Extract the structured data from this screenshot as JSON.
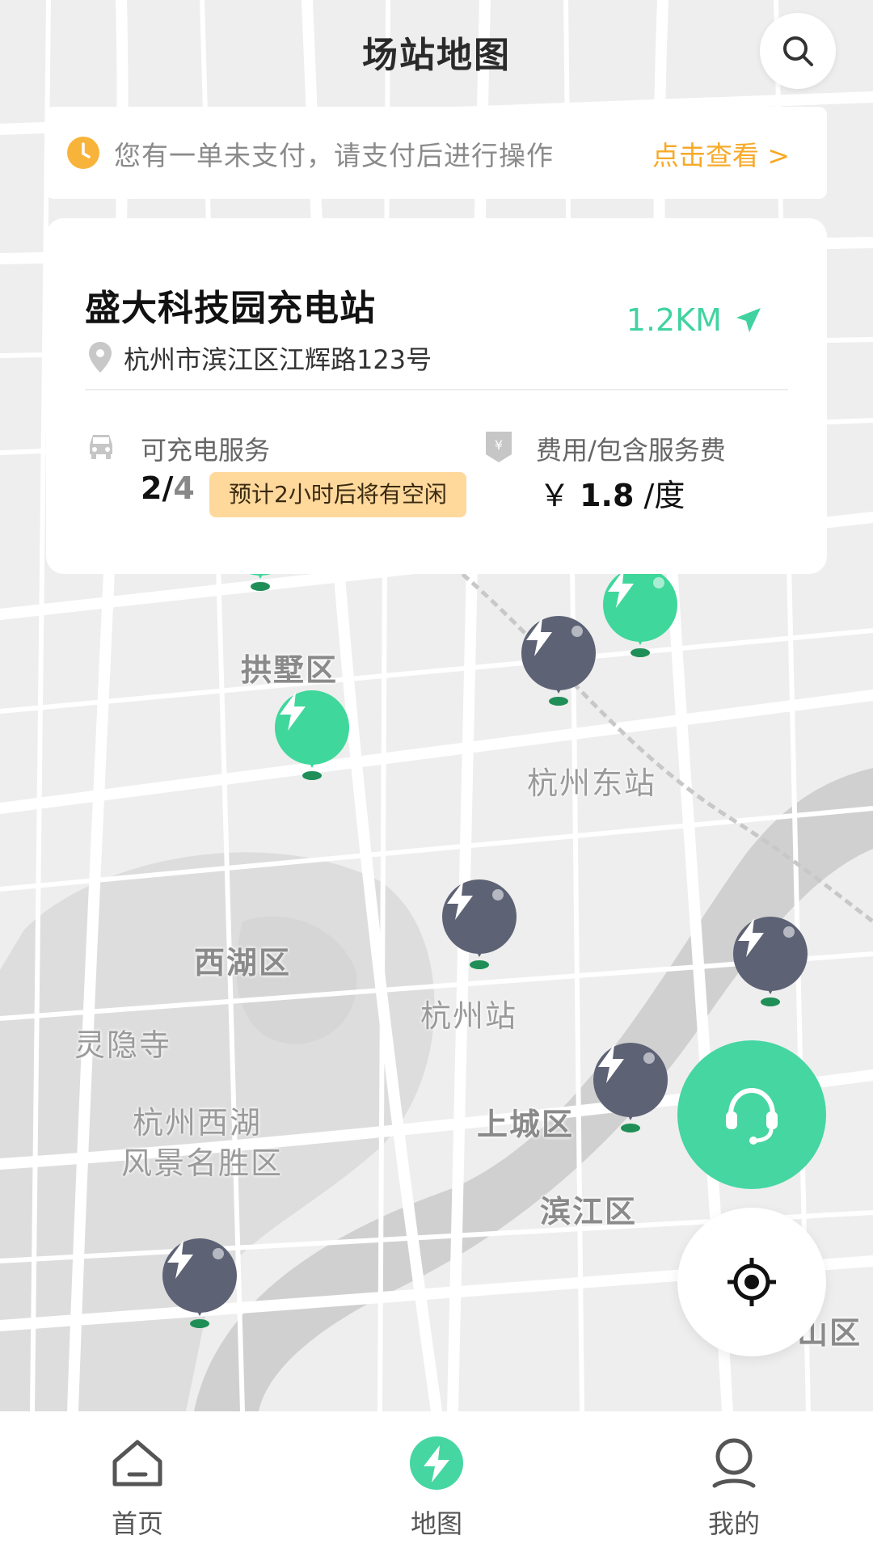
{
  "header": {
    "title": "场站地图"
  },
  "search": {
    "icon": "search-icon"
  },
  "notice": {
    "icon": "clock-icon",
    "message": "您有一单未支付，请支付后进行操作",
    "link": "点击查看 >",
    "accent_color": "#f7a928"
  },
  "station": {
    "name": "盛大科技园充电站",
    "distance": "1.2KM",
    "address": "杭州市滨江区江辉路123号",
    "service_label": "可充电服务",
    "available": "2",
    "separator": "/",
    "total": "4",
    "availability_note": "预计2小时后将有空闲",
    "fee_label": "费用/包含服务费",
    "currency": "￥",
    "price": "1.8",
    "unit": "/度",
    "accent_color": "#40d3a0"
  },
  "map": {
    "labels": {
      "gongshu": "拱墅区",
      "east_station": "杭州东站",
      "xihu": "西湖区",
      "lingyin": "灵隐寺",
      "hz_station": "杭州站",
      "westlake_1": "杭州西湖",
      "westlake_2": "风景名胜区",
      "shangcheng": "上城区",
      "binjiang": "滨江区",
      "partial_district": "山区"
    },
    "marker_colors": {
      "available": "#3fd79b",
      "busy": "#5d6275"
    }
  },
  "nav": {
    "items": [
      {
        "label": "首页",
        "icon": "home-icon"
      },
      {
        "label": "地图",
        "icon": "bolt-icon"
      },
      {
        "label": "我的",
        "icon": "user-icon"
      }
    ],
    "active_color": "#45d6a2"
  }
}
